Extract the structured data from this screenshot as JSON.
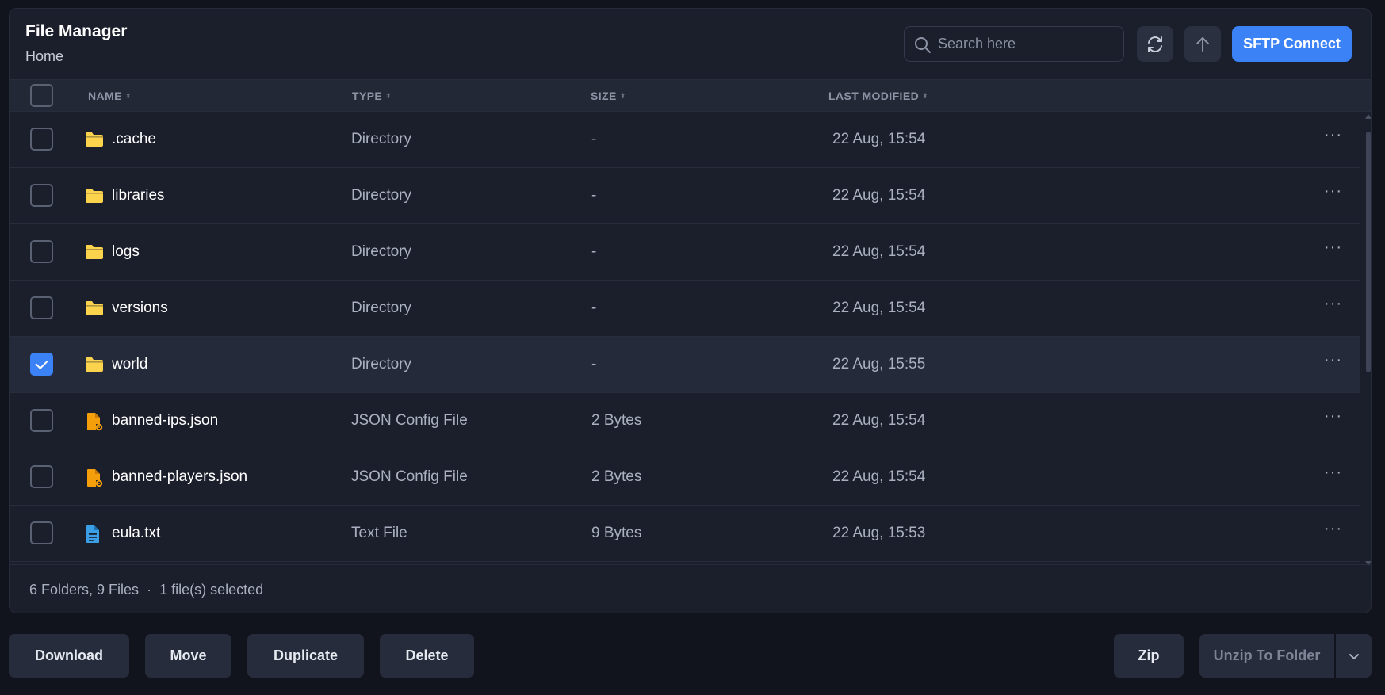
{
  "header": {
    "title": "File Manager",
    "breadcrumb": "Home",
    "search_placeholder": "Search here",
    "sftp_label": "SFTP Connect"
  },
  "table": {
    "columns": [
      "NAME",
      "TYPE",
      "SIZE",
      "LAST MODIFIED"
    ],
    "rows": [
      {
        "name": ".cache",
        "type": "Directory",
        "size": "-",
        "modified": "22 Aug, 15:54",
        "icon": "folder-icon",
        "selected": false
      },
      {
        "name": "libraries",
        "type": "Directory",
        "size": "-",
        "modified": "22 Aug, 15:54",
        "icon": "folder-icon",
        "selected": false
      },
      {
        "name": "logs",
        "type": "Directory",
        "size": "-",
        "modified": "22 Aug, 15:54",
        "icon": "folder-icon",
        "selected": false
      },
      {
        "name": "versions",
        "type": "Directory",
        "size": "-",
        "modified": "22 Aug, 15:54",
        "icon": "folder-icon",
        "selected": false
      },
      {
        "name": "world",
        "type": "Directory",
        "size": "-",
        "modified": "22 Aug, 15:55",
        "icon": "folder-icon",
        "selected": true
      },
      {
        "name": "banned-ips.json",
        "type": "JSON Config File",
        "size": "2 Bytes",
        "modified": "22 Aug, 15:54",
        "icon": "config-file-icon",
        "selected": false
      },
      {
        "name": "banned-players.json",
        "type": "JSON Config File",
        "size": "2 Bytes",
        "modified": "22 Aug, 15:54",
        "icon": "config-file-icon",
        "selected": false
      },
      {
        "name": "eula.txt",
        "type": "Text File",
        "size": "9 Bytes",
        "modified": "22 Aug, 15:53",
        "icon": "text-file-icon",
        "selected": false
      }
    ]
  },
  "footer": {
    "counts": "6 Folders, 9 Files",
    "separator": "·",
    "selection": "1 file(s) selected"
  },
  "actions": {
    "download": "Download",
    "move": "Move",
    "duplicate": "Duplicate",
    "delete": "Delete",
    "zip": "Zip",
    "unzip": "Unzip To Folder"
  },
  "colors": {
    "accent": "#3b82f6",
    "folder": "#fcd34d",
    "config_file": "#f59e0b",
    "text_file": "#3b9fe8"
  }
}
